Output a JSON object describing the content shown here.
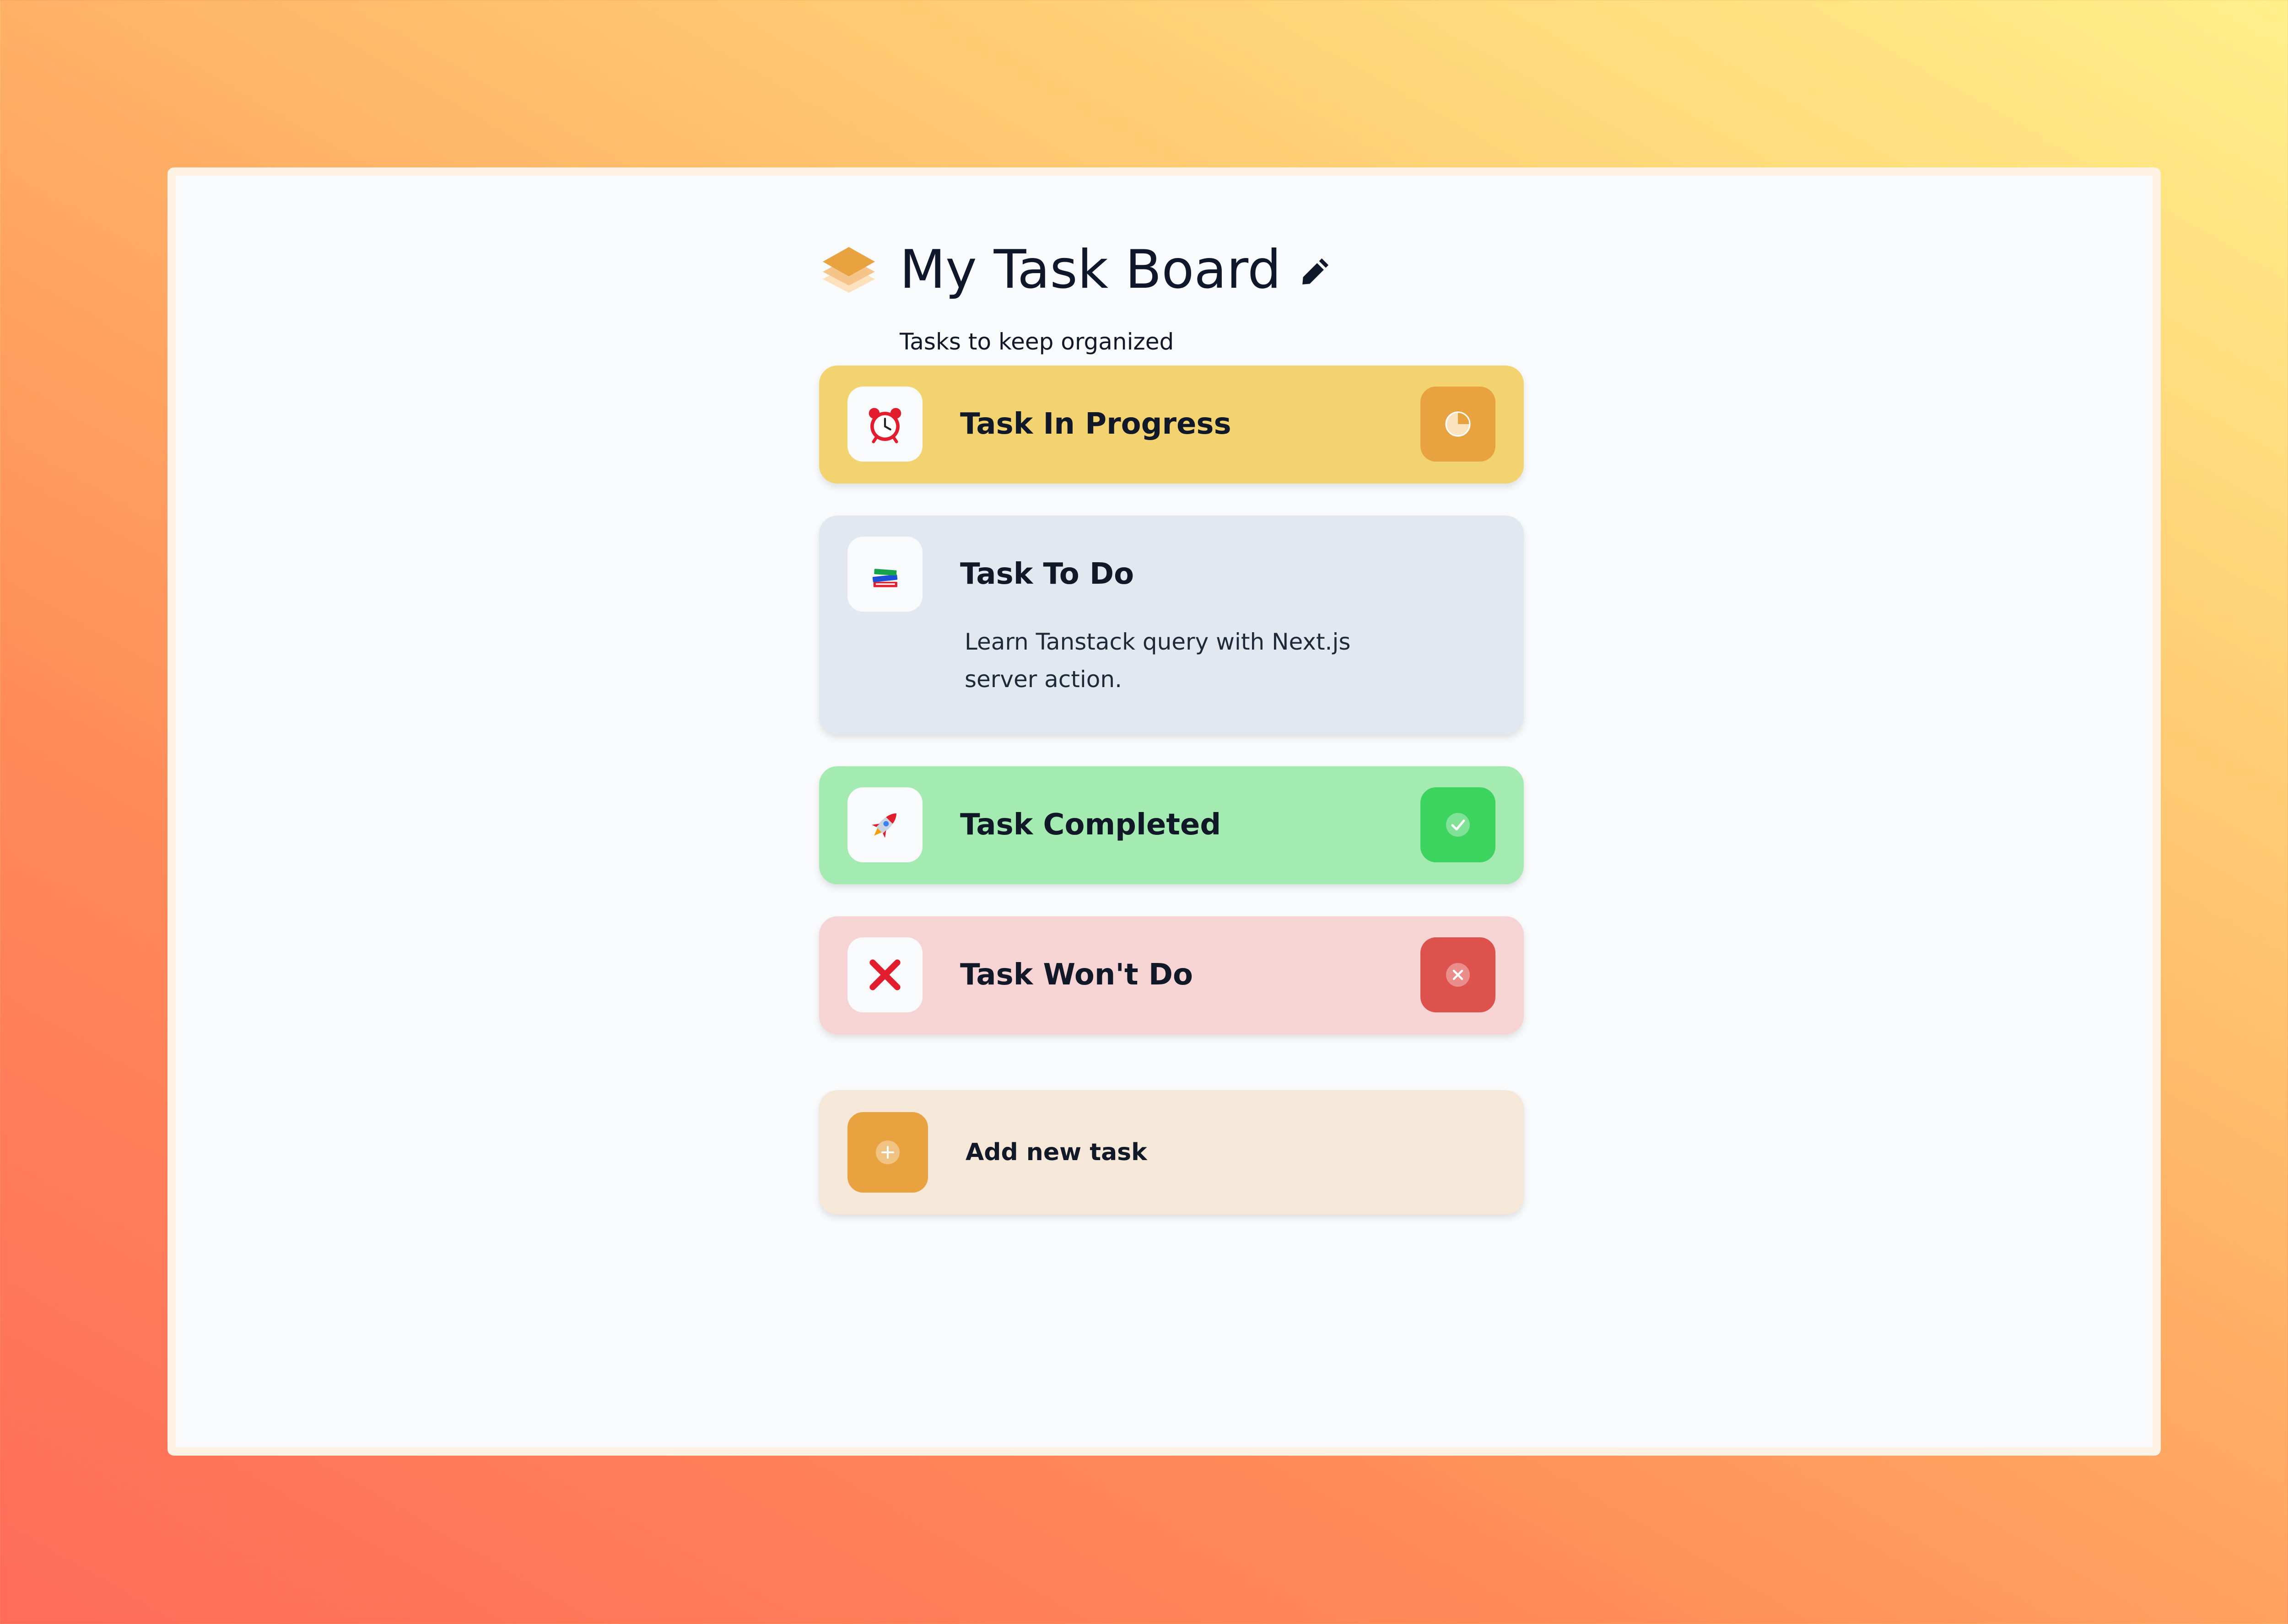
{
  "board": {
    "title": "My Task Board",
    "subtitle": "Tasks to keep organized",
    "logo_icon": "layers-icon",
    "edit_icon": "pencil-icon"
  },
  "tasks": [
    {
      "title": "Task In Progress",
      "description": "",
      "status": "in-progress",
      "emoji_icon": "alarm-clock-icon",
      "status_icon": "time-pie-icon",
      "card_color": "#f3d36f",
      "status_color": "#e8a340"
    },
    {
      "title": "Task To Do",
      "description": "Learn Tanstack query with Next.js server action.",
      "status": "todo",
      "emoji_icon": "books-icon",
      "card_color": "#e2e8f0"
    },
    {
      "title": "Task Completed",
      "description": "",
      "status": "completed",
      "emoji_icon": "rocket-icon",
      "status_icon": "check-icon",
      "card_color": "#a3ebb1",
      "status_color": "#3cd35f"
    },
    {
      "title": "Task Won't Do",
      "description": "",
      "status": "wont-do",
      "emoji_icon": "cross-mark-icon",
      "status_icon": "close-circle-icon",
      "card_color": "#f7d4d4",
      "status_color": "#dd524c"
    }
  ],
  "add_task": {
    "label": "Add new task",
    "icon": "plus-circle-icon",
    "color": "#e8a340"
  }
}
